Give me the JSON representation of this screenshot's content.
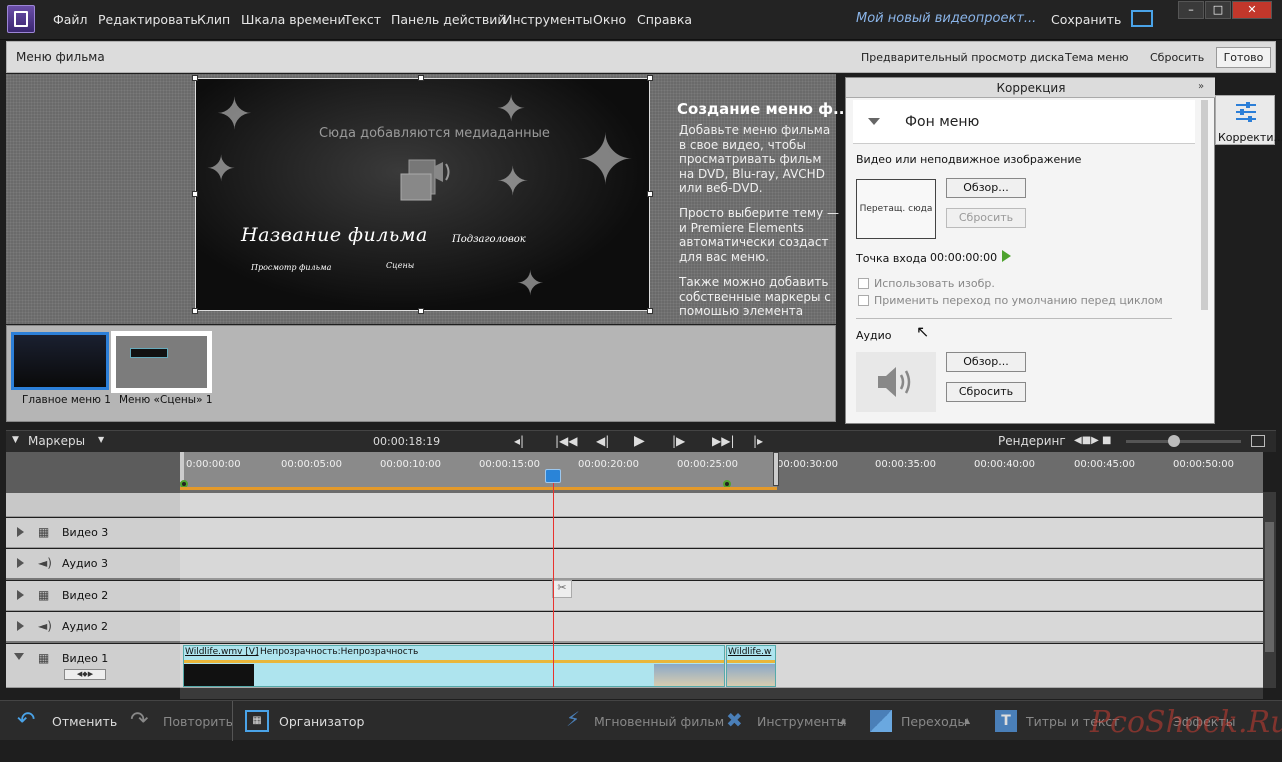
{
  "menubar": {
    "items": [
      "Файл",
      "Редактировать",
      "Клип",
      "Шкала времени",
      "Текст",
      "Панель действий",
      "Инструменты",
      "Окно",
      "Справка"
    ],
    "project_title": "Мой новый видеопроект...",
    "save": "Сохранить"
  },
  "movie_menu_bar": {
    "title": "Меню фильма",
    "preview_disc": "Предварительный просмотр диска",
    "menu_theme": "Тема меню",
    "reset": "Сбросить",
    "done": "Готово"
  },
  "preview": {
    "media_placeholder": "Сюда добавляются медиаданные",
    "movie_title": "Название фильма",
    "subtitle": "Подзаголовок",
    "play_movie": "Просмотр фильма",
    "scenes": "Сцены"
  },
  "info": {
    "heading": "Создание меню ф...",
    "p1": "Добавьте меню фильма в свое видео, чтобы просматривать фильм на DVD, Blu-ray, AVCHD или веб-DVD.",
    "p2": "Просто выберите тему — и Premiere Elements автоматически создаст для вас меню.",
    "p3": "Также можно добавить собственные маркеры с помощью элемента"
  },
  "thumbnails": [
    {
      "label": "Главное меню 1",
      "selected": true
    },
    {
      "label": "Меню «Сцены» 1",
      "selected": false
    }
  ],
  "correction": {
    "header": "Коррекция",
    "section": "Фон меню",
    "video_label": "Видео или неподвижное изображение",
    "drop_here": "Перетащ. сюда",
    "browse": "Обзор...",
    "reset": "Сбросить",
    "in_point_label": "Точка входа",
    "in_point_value": "00:00:00:00",
    "use_image": "Использовать изобр.",
    "apply_transition": "Применить переход по умолчанию перед циклом",
    "audio_label": "Аудио",
    "audio_browse": "Обзор...",
    "audio_reset": "Сбросить"
  },
  "side_tab": {
    "label": "Корректи..."
  },
  "transport": {
    "markers": "Маркеры",
    "timecode": "00:00:18:19",
    "render": "Рендеринг"
  },
  "ruler": {
    "ticks": [
      "0:00:00:00",
      "00:00:05:00",
      "00:00:10:00",
      "00:00:15:00",
      "00:00:20:00",
      "00:00:25:00",
      "00:00:30:00",
      "00:00:35:00",
      "00:00:40:00",
      "00:00:45:00",
      "00:00:50:00"
    ]
  },
  "tracks": [
    {
      "name": "Видео 3",
      "type": "video"
    },
    {
      "name": "Аудио 3",
      "type": "audio"
    },
    {
      "name": "Видео 2",
      "type": "video"
    },
    {
      "name": "Аудио 2",
      "type": "audio"
    },
    {
      "name": "Видео 1",
      "type": "video"
    }
  ],
  "clip": {
    "name": "Wildlife.wmv [V]",
    "effect": "Непрозрачность:Непрозрачность",
    "second_name": "Wildlife.w"
  },
  "bottombar": {
    "undo": "Отменить",
    "redo": "Повторить",
    "organizer": "Организатор",
    "instant_movie": "Мгновенный фильм",
    "tools": "Инструменты",
    "transitions": "Переходы",
    "titles": "Титры и текст",
    "effects": "Эффекты"
  },
  "watermark": "PcoShock.Ru",
  "colors": {
    "accent": "#2c7fd8",
    "playhead": "#e8322e",
    "workarea": "#e49a2a",
    "play_green": "#4ea32e"
  }
}
